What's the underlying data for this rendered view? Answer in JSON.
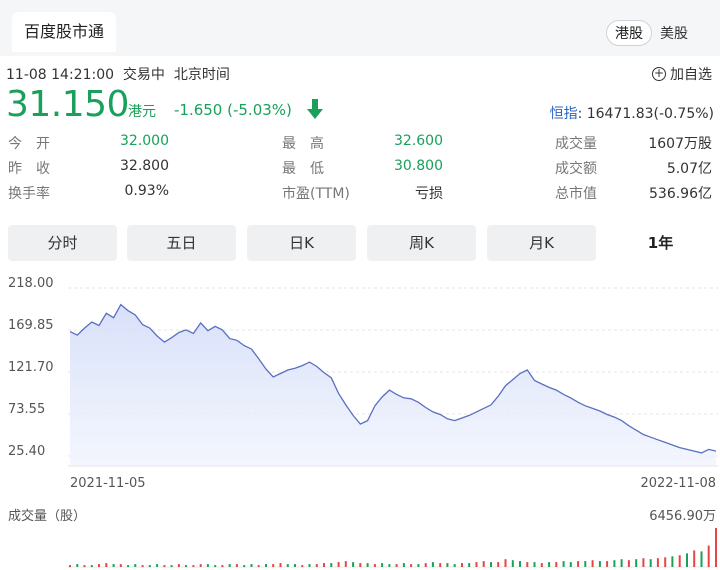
{
  "header": {
    "tab_label": "百度股市通",
    "market_tabs": [
      {
        "label": "港股",
        "active": true
      },
      {
        "label": "美股",
        "active": false
      }
    ]
  },
  "quote": {
    "timestamp": "11-08 14:21:00",
    "status": "交易中",
    "timezone": "北京时间",
    "add_watchlist": "加自选",
    "price": "31.150",
    "currency": "港元",
    "change": "-1.650 (-5.03%)",
    "direction": "down",
    "index_label": "恒指",
    "index_value": ": 16471.83(-0.75%)"
  },
  "stats": [
    [
      {
        "label": "今　开",
        "value": "32.000",
        "color": "green"
      },
      {
        "label": "最　高",
        "value": "32.600",
        "color": "green"
      },
      {
        "label": "成交量",
        "value": "1607万股",
        "color": "normal"
      }
    ],
    [
      {
        "label": "昨　收",
        "value": "32.800",
        "color": "normal"
      },
      {
        "label": "最　低",
        "value": "30.800",
        "color": "green"
      },
      {
        "label": "成交额",
        "value": "5.07亿",
        "color": "normal"
      }
    ],
    [
      {
        "label": "换手率",
        "value": "0.93%",
        "color": "normal"
      },
      {
        "label": "市盈(TTM)",
        "value": "亏损",
        "color": "normal"
      },
      {
        "label": "总市值",
        "value": "536.96亿",
        "color": "normal"
      }
    ]
  ],
  "period_tabs": [
    {
      "label": "分时",
      "active": false
    },
    {
      "label": "五日",
      "active": false
    },
    {
      "label": "日K",
      "active": false
    },
    {
      "label": "周K",
      "active": false
    },
    {
      "label": "月K",
      "active": false
    },
    {
      "label": "1年",
      "active": true
    }
  ],
  "colors": {
    "down": "#19a05a",
    "up": "#e64545",
    "line": "#5a6fc0",
    "fill": "#dfe6fb"
  },
  "chart_data": {
    "type": "area",
    "y_ticks": [
      "218.00",
      "169.85",
      "121.70",
      "73.55",
      "25.40"
    ],
    "ylim": [
      25.4,
      218.0
    ],
    "x_start_label": "2021-11-05",
    "x_end_label": "2022-11-08",
    "volume_label": "成交量（股）",
    "volume_max_label": "6456.90万",
    "prices": [
      168,
      164,
      172,
      179,
      175,
      189,
      184,
      199,
      192,
      187,
      176,
      172,
      163,
      156,
      161,
      167,
      170,
      166,
      178,
      169,
      174,
      170,
      160,
      158,
      152,
      148,
      137,
      125,
      116,
      120,
      124,
      126,
      129,
      133,
      128,
      121,
      115,
      97,
      84,
      72,
      62,
      66,
      83,
      93,
      101,
      96,
      92,
      91,
      87,
      81,
      76,
      73,
      68,
      66,
      69,
      72,
      76,
      80,
      84,
      94,
      106,
      113,
      120,
      124,
      112,
      108,
      104,
      101,
      96,
      92,
      87,
      83,
      80,
      77,
      73,
      70,
      66,
      60,
      55,
      50,
      47,
      44,
      41,
      38,
      35,
      33,
      31,
      29,
      33,
      31
    ],
    "volumes": [
      2,
      3,
      2,
      2,
      3,
      4,
      3,
      3,
      2,
      3,
      2,
      2,
      3,
      2,
      2,
      3,
      2,
      2,
      3,
      3,
      2,
      2,
      3,
      3,
      2,
      3,
      2,
      3,
      3,
      4,
      3,
      3,
      2,
      3,
      3,
      4,
      4,
      5,
      6,
      5,
      4,
      4,
      3,
      4,
      3,
      3,
      4,
      3,
      3,
      4,
      5,
      4,
      4,
      3,
      4,
      4,
      5,
      6,
      5,
      5,
      8,
      7,
      6,
      5,
      5,
      4,
      5,
      5,
      6,
      5,
      6,
      6,
      7,
      6,
      6,
      7,
      8,
      7,
      8,
      9,
      8,
      9,
      10,
      11,
      12,
      14,
      17,
      16,
      22,
      40
    ],
    "volume_colors": [
      "up",
      "down",
      "up",
      "down",
      "up",
      "up",
      "down",
      "up",
      "down",
      "down",
      "up",
      "down",
      "down",
      "up",
      "down",
      "up",
      "down",
      "up",
      "up",
      "down",
      "down",
      "up",
      "down",
      "up",
      "down",
      "down",
      "up",
      "down",
      "up",
      "up",
      "down",
      "down",
      "up",
      "down",
      "up",
      "up",
      "down",
      "up",
      "up",
      "down",
      "up",
      "down",
      "up",
      "down",
      "down",
      "up",
      "down",
      "up",
      "down",
      "up",
      "down",
      "up",
      "down",
      "down",
      "up",
      "down",
      "up",
      "up",
      "down",
      "up",
      "up",
      "down",
      "down",
      "up",
      "down",
      "up",
      "down",
      "up",
      "down",
      "down",
      "up",
      "down",
      "up",
      "down",
      "up",
      "down",
      "down",
      "up",
      "down",
      "up",
      "down",
      "up",
      "up",
      "down",
      "up",
      "down",
      "up",
      "down",
      "up",
      "up"
    ]
  }
}
